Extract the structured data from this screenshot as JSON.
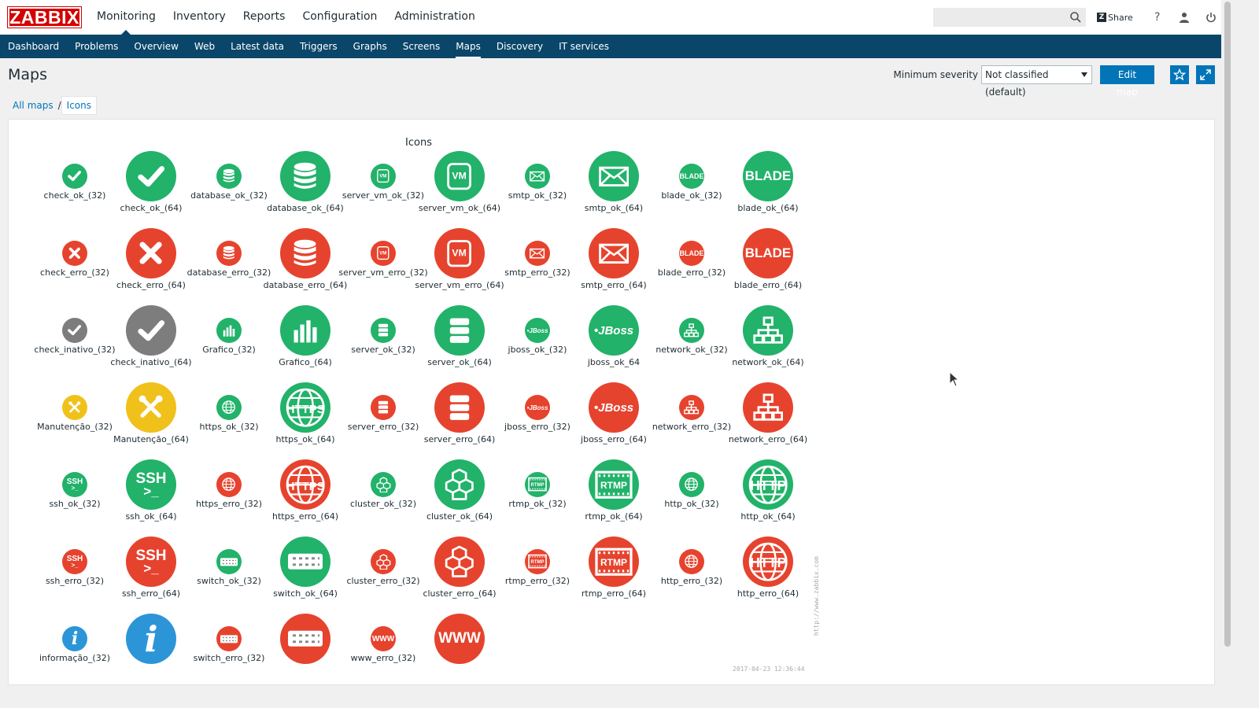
{
  "brand": "ZABBIX",
  "main_menu": [
    "Monitoring",
    "Inventory",
    "Reports",
    "Configuration",
    "Administration"
  ],
  "search": {
    "placeholder": "",
    "value": ""
  },
  "header_actions": {
    "share": "Share",
    "help": "?"
  },
  "sub_menu": [
    "Dashboard",
    "Problems",
    "Overview",
    "Web",
    "Latest data",
    "Triggers",
    "Graphs",
    "Screens",
    "Maps",
    "Discovery",
    "IT services"
  ],
  "page": {
    "title": "Maps",
    "min_severity_label": "Minimum severity",
    "min_severity_value": "Not classified (default)",
    "edit_map": "Edit map"
  },
  "breadcrumb": [
    "All maps",
    "Icons"
  ],
  "map": {
    "title": "Icons",
    "watermark": "http://www.zabbix.com",
    "timestamp": "2017-04-23 12:36:44",
    "elements": [
      {
        "label": "check_ok_(32)",
        "color": "green",
        "icon": "check-icon",
        "size": 32
      },
      {
        "label": "check_ok_(64)",
        "color": "green",
        "icon": "check-icon",
        "size": 64
      },
      {
        "label": "database_ok_(32)",
        "color": "green",
        "icon": "database-icon",
        "size": 32
      },
      {
        "label": "database_ok_(64)",
        "color": "green",
        "icon": "database-icon",
        "size": 64
      },
      {
        "label": "server_vm_ok_(32)",
        "color": "green",
        "icon": "vm-icon",
        "size": 32
      },
      {
        "label": "server_vm_ok_(64)",
        "color": "green",
        "icon": "vm-icon",
        "size": 64
      },
      {
        "label": "smtp_ok_(32)",
        "color": "green",
        "icon": "envelope-icon",
        "size": 32
      },
      {
        "label": "smtp_ok_(64)",
        "color": "green",
        "icon": "envelope-icon",
        "size": 64
      },
      {
        "label": "blade_ok_(32)",
        "color": "green",
        "icon": "blade-icon",
        "size": 32
      },
      {
        "label": "blade_ok_(64)",
        "color": "green",
        "icon": "blade-icon",
        "size": 64
      },
      {
        "label": "check_erro_(32)",
        "color": "red",
        "icon": "cross-icon",
        "size": 32
      },
      {
        "label": "check_erro_(64)",
        "color": "red",
        "icon": "cross-icon",
        "size": 64
      },
      {
        "label": "database_erro_(32)",
        "color": "red",
        "icon": "database-icon",
        "size": 32
      },
      {
        "label": "database_erro_(64)",
        "color": "red",
        "icon": "database-icon",
        "size": 64
      },
      {
        "label": "server_vm_erro_(32)",
        "color": "red",
        "icon": "vm-icon",
        "size": 32
      },
      {
        "label": "server_vm_erro_(64)",
        "color": "red",
        "icon": "vm-icon",
        "size": 64
      },
      {
        "label": "smtp_erro_(32)",
        "color": "red",
        "icon": "envelope-icon",
        "size": 32
      },
      {
        "label": "smtp_erro_(64)",
        "color": "red",
        "icon": "envelope-icon",
        "size": 64
      },
      {
        "label": "blade_erro_(32)",
        "color": "red",
        "icon": "blade-icon",
        "size": 32
      },
      {
        "label": "blade_erro_(64)",
        "color": "red",
        "icon": "blade-icon",
        "size": 64
      },
      {
        "label": "check_inativo_(32)",
        "color": "gray",
        "icon": "check-icon",
        "size": 32
      },
      {
        "label": "check_inativo_(64)",
        "color": "gray",
        "icon": "check-icon",
        "size": 64
      },
      {
        "label": "Grafico_(32)",
        "color": "green",
        "icon": "bar-chart-icon",
        "size": 32
      },
      {
        "label": "Grafico_(64)",
        "color": "green",
        "icon": "bar-chart-icon",
        "size": 64
      },
      {
        "label": "server_ok_(32)",
        "color": "green",
        "icon": "server-icon",
        "size": 32
      },
      {
        "label": "server_ok_(64)",
        "color": "green",
        "icon": "server-icon",
        "size": 64
      },
      {
        "label": "jboss_ok_(32)",
        "color": "green",
        "icon": "jboss-icon",
        "size": 32
      },
      {
        "label": "jboss_ok_64",
        "color": "green",
        "icon": "jboss-icon",
        "size": 64
      },
      {
        "label": "network_ok_(32)",
        "color": "green",
        "icon": "network-icon",
        "size": 32
      },
      {
        "label": "network_ok_(64)",
        "color": "green",
        "icon": "network-icon",
        "size": 64
      },
      {
        "label": "Manutenção_(32)",
        "color": "yellow",
        "icon": "tools-icon",
        "size": 32
      },
      {
        "label": "Manutenção_(64)",
        "color": "yellow",
        "icon": "tools-icon",
        "size": 64
      },
      {
        "label": "https_ok_(32)",
        "color": "green",
        "icon": "globe-icon",
        "size": 32
      },
      {
        "label": "https_ok_(64)",
        "color": "green",
        "icon": "https-icon",
        "size": 64
      },
      {
        "label": "server_erro_(32)",
        "color": "red",
        "icon": "server-icon",
        "size": 32
      },
      {
        "label": "server_erro_(64)",
        "color": "red",
        "icon": "server-icon",
        "size": 64
      },
      {
        "label": "jboss_erro_(32)",
        "color": "red",
        "icon": "jboss-icon",
        "size": 32
      },
      {
        "label": "jboss_erro_(64)",
        "color": "red",
        "icon": "jboss-icon",
        "size": 64
      },
      {
        "label": "network_erro_(32)",
        "color": "red",
        "icon": "network-icon",
        "size": 32
      },
      {
        "label": "network_erro_(64)",
        "color": "red",
        "icon": "network-icon",
        "size": 64
      },
      {
        "label": "ssh_ok_(32)",
        "color": "green",
        "icon": "ssh-icon",
        "size": 32
      },
      {
        "label": "ssh_ok_(64)",
        "color": "green",
        "icon": "ssh-icon",
        "size": 64
      },
      {
        "label": "https_erro_(32)",
        "color": "red",
        "icon": "globe-icon",
        "size": 32
      },
      {
        "label": "https_erro_(64)",
        "color": "red",
        "icon": "https-icon",
        "size": 64
      },
      {
        "label": "cluster_ok_(32)",
        "color": "green",
        "icon": "cluster-icon",
        "size": 32
      },
      {
        "label": "cluster_ok_(64)",
        "color": "green",
        "icon": "cluster-icon",
        "size": 64
      },
      {
        "label": "rtmp_ok_(32)",
        "color": "green",
        "icon": "rtmp-icon",
        "size": 32
      },
      {
        "label": "rtmp_ok_(64)",
        "color": "green",
        "icon": "rtmp-icon",
        "size": 64
      },
      {
        "label": "http_ok_(32)",
        "color": "green",
        "icon": "globe-icon",
        "size": 32
      },
      {
        "label": "http_ok_(64)",
        "color": "green",
        "icon": "http-icon",
        "size": 64
      },
      {
        "label": "ssh_erro_(32)",
        "color": "red",
        "icon": "ssh-icon",
        "size": 32
      },
      {
        "label": "ssh_erro_(64)",
        "color": "red",
        "icon": "ssh-icon",
        "size": 64
      },
      {
        "label": "switch_ok_(32)",
        "color": "green",
        "icon": "switch-icon",
        "size": 32
      },
      {
        "label": "switch_ok_(64)",
        "color": "green",
        "icon": "switch-icon",
        "size": 64
      },
      {
        "label": "cluster_erro_(32)",
        "color": "red",
        "icon": "cluster-icon",
        "size": 32
      },
      {
        "label": "cluster_erro_(64)",
        "color": "red",
        "icon": "cluster-icon",
        "size": 64
      },
      {
        "label": "rtmp_erro_(32)",
        "color": "red",
        "icon": "rtmp-icon",
        "size": 32
      },
      {
        "label": "rtmp_erro_(64)",
        "color": "red",
        "icon": "rtmp-icon",
        "size": 64
      },
      {
        "label": "http_erro_(32)",
        "color": "red",
        "icon": "globe-icon",
        "size": 32
      },
      {
        "label": "http_erro_(64)",
        "color": "red",
        "icon": "http-icon",
        "size": 64
      },
      {
        "label": "informação_(32)",
        "color": "blue",
        "icon": "info-icon",
        "size": 32
      },
      {
        "label": "",
        "color": "blue",
        "icon": "info-icon",
        "size": 64
      },
      {
        "label": "switch_erro_(32)",
        "color": "red",
        "icon": "switch-icon",
        "size": 32
      },
      {
        "label": "",
        "color": "red",
        "icon": "switch-icon",
        "size": 64
      },
      {
        "label": "www_erro_(32)",
        "color": "red",
        "icon": "www-icon",
        "size": 32
      },
      {
        "label": "",
        "color": "red",
        "icon": "www-icon",
        "size": 64
      }
    ]
  }
}
